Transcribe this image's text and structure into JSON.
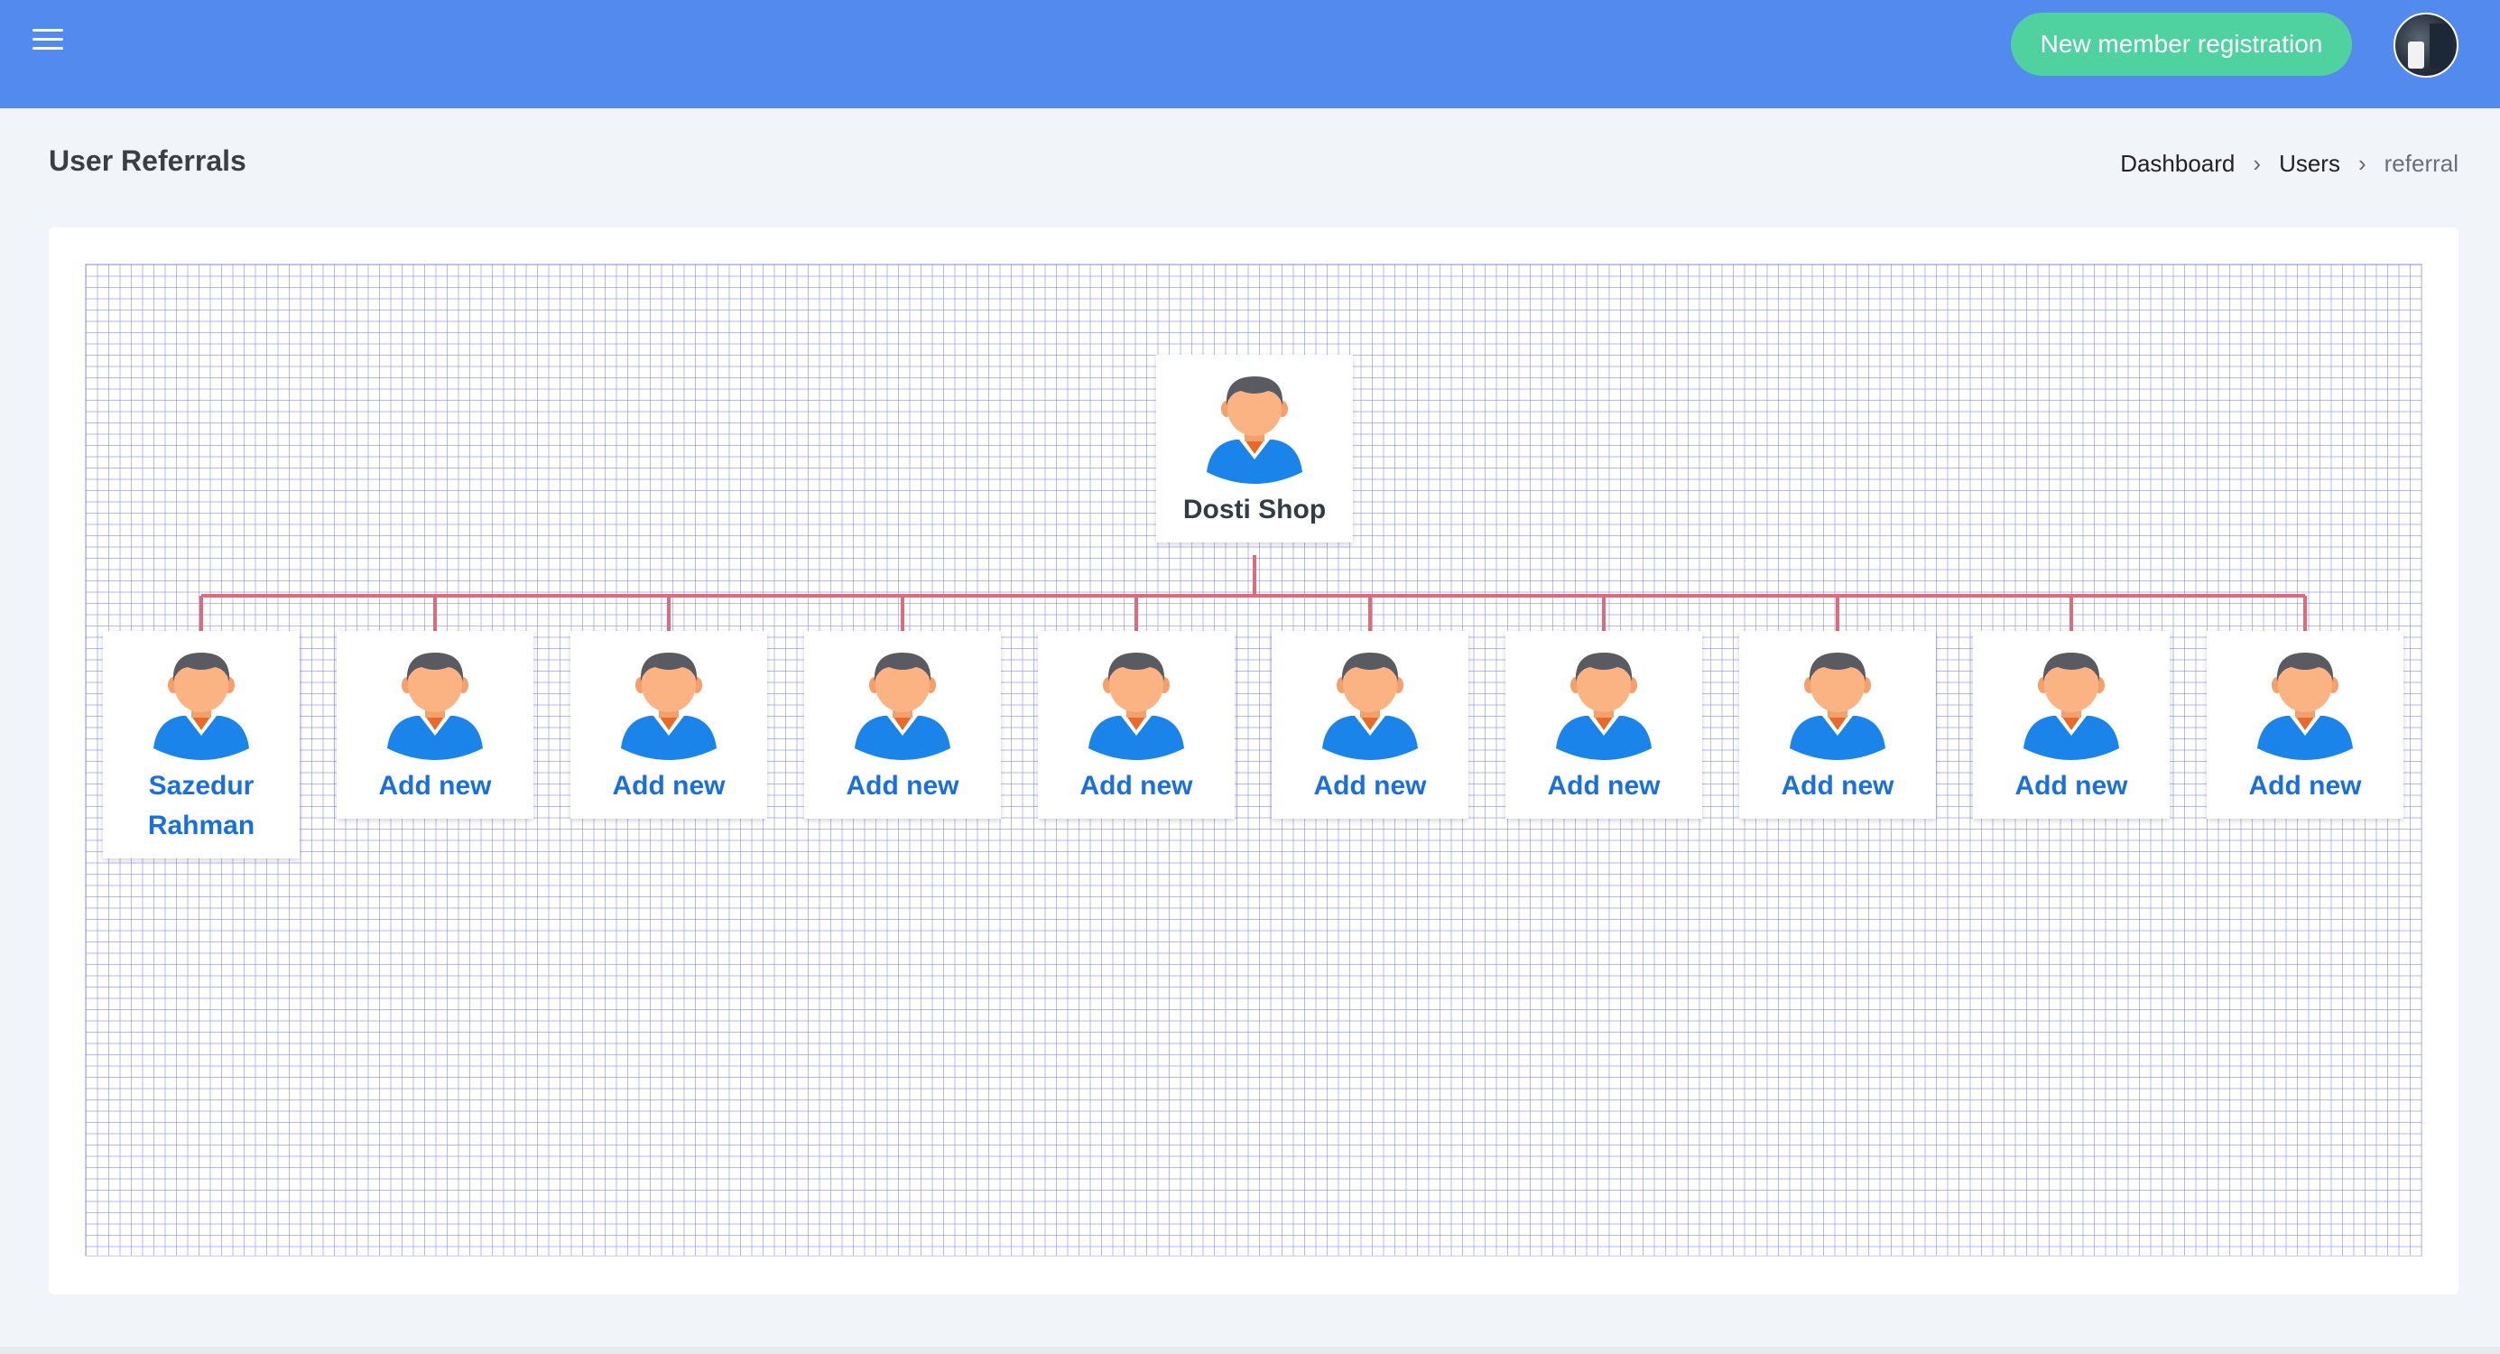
{
  "header": {
    "menu_icon": "hamburger-icon",
    "register_button": "New member registration",
    "profile_avatar": "avatar"
  },
  "page": {
    "title": "User Referrals",
    "breadcrumb": [
      "Dashboard",
      "Users",
      "referral"
    ],
    "breadcrumb_separator_icon": "chevron-right-icon"
  },
  "tree": {
    "root": {
      "name": "Dosti Shop",
      "icon": "user-icon"
    },
    "children": [
      {
        "label": "Sazedur Rahman",
        "icon": "user-icon"
      },
      {
        "label": "Add new",
        "icon": "user-icon"
      },
      {
        "label": "Add new",
        "icon": "user-icon"
      },
      {
        "label": "Add new",
        "icon": "user-icon"
      },
      {
        "label": "Add new",
        "icon": "user-icon"
      },
      {
        "label": "Add new",
        "icon": "user-icon"
      },
      {
        "label": "Add new",
        "icon": "user-icon"
      },
      {
        "label": "Add new",
        "icon": "user-icon"
      },
      {
        "label": "Add new",
        "icon": "user-icon"
      },
      {
        "label": "Add new",
        "icon": "user-icon"
      }
    ],
    "connector_color": "#e06b78",
    "label_color": "#1a6fe0"
  },
  "colors": {
    "topbar": "#528aee",
    "register_button": "#4fd1a0",
    "background": "#f1f4f8"
  }
}
